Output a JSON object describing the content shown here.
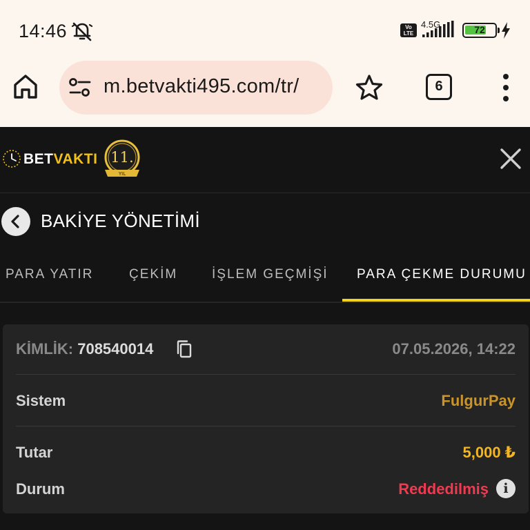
{
  "status_bar": {
    "time": "14:46",
    "volte": "Vo\nLTE",
    "network": "4.5G",
    "battery_level": "72",
    "battery_percent": 72,
    "icons": [
      "bell-off-icon",
      "signal-icon",
      "battery-icon",
      "charging-bolt-icon"
    ]
  },
  "browser": {
    "url": "m.betvakti495.com/tr/",
    "tab_count": "6",
    "icons": [
      "home-icon",
      "site-settings-icon",
      "bookmark-star-icon",
      "tab-switcher-icon",
      "more-vert-icon"
    ]
  },
  "app": {
    "logo_part1": "BET",
    "logo_part2": "VAKTI",
    "badge_text": "11.",
    "badge_sub": "YIL"
  },
  "section": {
    "title": "BAKİYE YÖNETİMİ"
  },
  "tabs": [
    {
      "label": "PARA YATIR"
    },
    {
      "label": "ÇEKİM"
    },
    {
      "label": "İŞLEM GEÇMİŞİ"
    },
    {
      "label": "PARA ÇEKME DURUMU",
      "active": true
    }
  ],
  "card": {
    "id_label": "KİMLİK:",
    "id_value": "708540014",
    "date": "07.05.2026, 14:22",
    "system_label": "Sistem",
    "system_value": "FulgurPay",
    "amount_label": "Tutar",
    "amount_value": "5,000 ₺",
    "status_label": "Durum",
    "status_value": "Reddedilmiş",
    "info_glyph": "i"
  },
  "colors": {
    "accent": "#f2d31c",
    "gold": "#c9952a",
    "amount": "#f2b622",
    "rejected": "#ef3a4f",
    "background": "#141414",
    "card": "#242424"
  }
}
